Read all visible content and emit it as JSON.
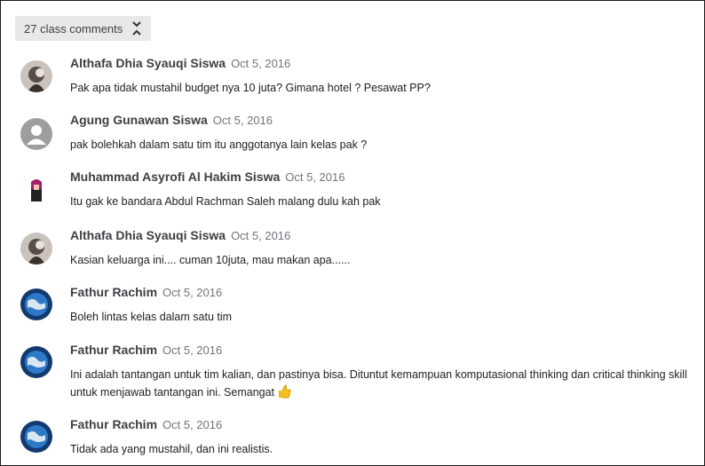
{
  "toggle": {
    "label": "27 class comments",
    "icon": "expand-collapse-icon"
  },
  "comments": [
    {
      "author": "Althafa Dhia Syauqi Siswa",
      "date": "Oct 5, 2016",
      "text": "Pak apa tidak mustahil budget nya 10 juta? Gimana hotel ? Pesawat PP?",
      "avatar": "cat-photo"
    },
    {
      "author": "Agung Gunawan Siswa",
      "date": "Oct 5, 2016",
      "text": "pak bolehkah dalam satu tim itu anggotanya lain kelas pak ?",
      "avatar": "default-person"
    },
    {
      "author": "Muhammad Asyrofi Al Hakim Siswa",
      "date": "Oct 5, 2016",
      "text": "Itu gak ke bandara Abdul Rachman Saleh malang dulu kah pak",
      "avatar": "character-photo"
    },
    {
      "author": "Althafa Dhia Syauqi Siswa",
      "date": "Oct 5, 2016",
      "text": "Kasian keluarga ini.... cuman 10juta, mau makan apa......",
      "avatar": "cat-photo"
    },
    {
      "author": "Fathur Rachim",
      "date": "Oct 5, 2016",
      "text": "Boleh lintas kelas dalam satu tim",
      "avatar": "globe-photo"
    },
    {
      "author": "Fathur Rachim",
      "date": "Oct 5, 2016",
      "text": "Ini adalah tantangan untuk tim kalian, dan pastinya bisa. Dituntut kemampuan komputasional thinking dan critical thinking skill untuk menjawab tantangan ini. Semangat",
      "avatar": "globe-photo",
      "emoji": "thumbs-up-icon"
    },
    {
      "author": "Fathur Rachim",
      "date": "Oct 5, 2016",
      "text": "Tidak ada yang mustahil, dan ini realistis.",
      "avatar": "globe-photo"
    }
  ]
}
